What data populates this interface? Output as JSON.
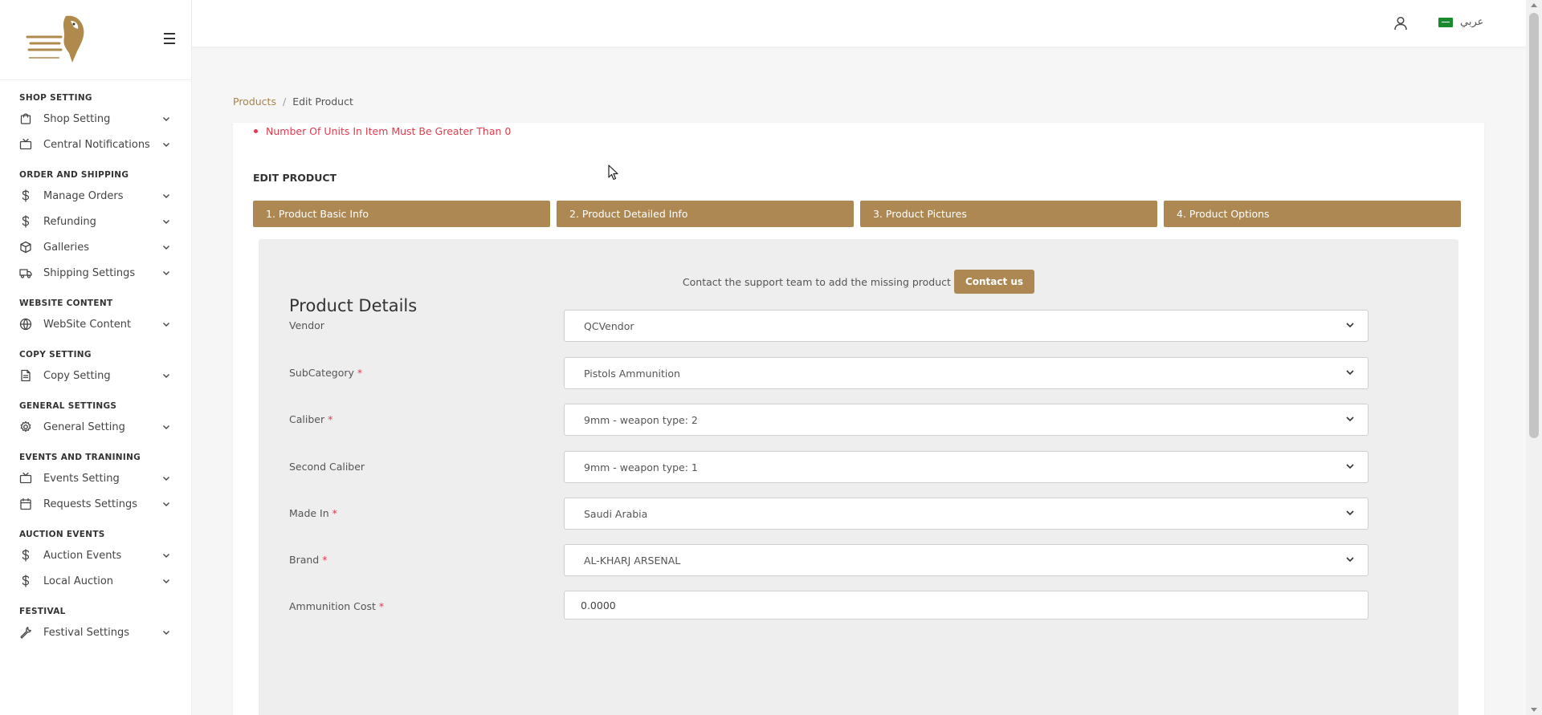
{
  "sidebar": {
    "sections": [
      {
        "title": "SHOP SETTING",
        "items": [
          {
            "label": "Shop Setting",
            "icon": "shopping-bag-icon"
          },
          {
            "label": "Central Notifications",
            "icon": "tv-icon"
          }
        ]
      },
      {
        "title": "ORDER AND SHIPPING",
        "items": [
          {
            "label": "Manage Orders",
            "icon": "dollar-icon"
          },
          {
            "label": "Refunding",
            "icon": "dollar-icon"
          },
          {
            "label": "Galleries",
            "icon": "box-icon"
          },
          {
            "label": "Shipping Settings",
            "icon": "truck-icon"
          }
        ]
      },
      {
        "title": "WEBSITE CONTENT",
        "items": [
          {
            "label": "WebSite Content",
            "icon": "globe-icon"
          }
        ]
      },
      {
        "title": "COPY SETTING",
        "items": [
          {
            "label": "Copy Setting",
            "icon": "document-icon"
          }
        ]
      },
      {
        "title": "GENERAL SETTINGS",
        "items": [
          {
            "label": "General Setting",
            "icon": "gear-icon"
          }
        ]
      },
      {
        "title": "EVENTS AND TRANINING",
        "items": [
          {
            "label": "Events Setting",
            "icon": "tv-icon"
          },
          {
            "label": "Requests Settings",
            "icon": "calendar-icon"
          }
        ]
      },
      {
        "title": "AUCTION EVENTS",
        "items": [
          {
            "label": "Auction Events",
            "icon": "dollar-icon"
          },
          {
            "label": "Local Auction",
            "icon": "dollar-icon"
          }
        ]
      },
      {
        "title": "FESTIVAL",
        "items": [
          {
            "label": "Festival Settings",
            "icon": "tool-icon"
          }
        ]
      }
    ]
  },
  "header": {
    "language": "عربي"
  },
  "breadcrumb": {
    "parent": "Products",
    "separator": "/",
    "current": "Edit Product"
  },
  "errors": [
    "Number Of Units In Item Must Be Greater Than 0"
  ],
  "page": {
    "section_title": "EDIT PRODUCT",
    "steps": [
      "1. Product Basic Info",
      "2. Product Detailed Info",
      "3. Product Pictures",
      "4. Product Options"
    ],
    "support_text": "Contact the support team to add the missing product",
    "contact_button": "Contact us",
    "form_title": "Product Details"
  },
  "fields": [
    {
      "label": "Vendor",
      "required": false,
      "type": "select",
      "value": "QCVendor"
    },
    {
      "label": "SubCategory",
      "required": true,
      "type": "select",
      "value": "Pistols Ammunition"
    },
    {
      "label": "Caliber",
      "required": true,
      "type": "select",
      "value": "9mm - weapon type: 2"
    },
    {
      "label": "Second Caliber",
      "required": false,
      "type": "select",
      "value": "9mm - weapon type: 1"
    },
    {
      "label": "Made In",
      "required": true,
      "type": "select",
      "value": "Saudi Arabia"
    },
    {
      "label": "Brand",
      "required": true,
      "type": "select",
      "value": "AL-KHARJ ARSENAL"
    },
    {
      "label": "Ammunition Cost",
      "required": true,
      "type": "input",
      "value": "0.0000"
    }
  ],
  "colors": {
    "accent": "#ad8852",
    "link": "#a8834a",
    "error": "#e03b4e"
  }
}
